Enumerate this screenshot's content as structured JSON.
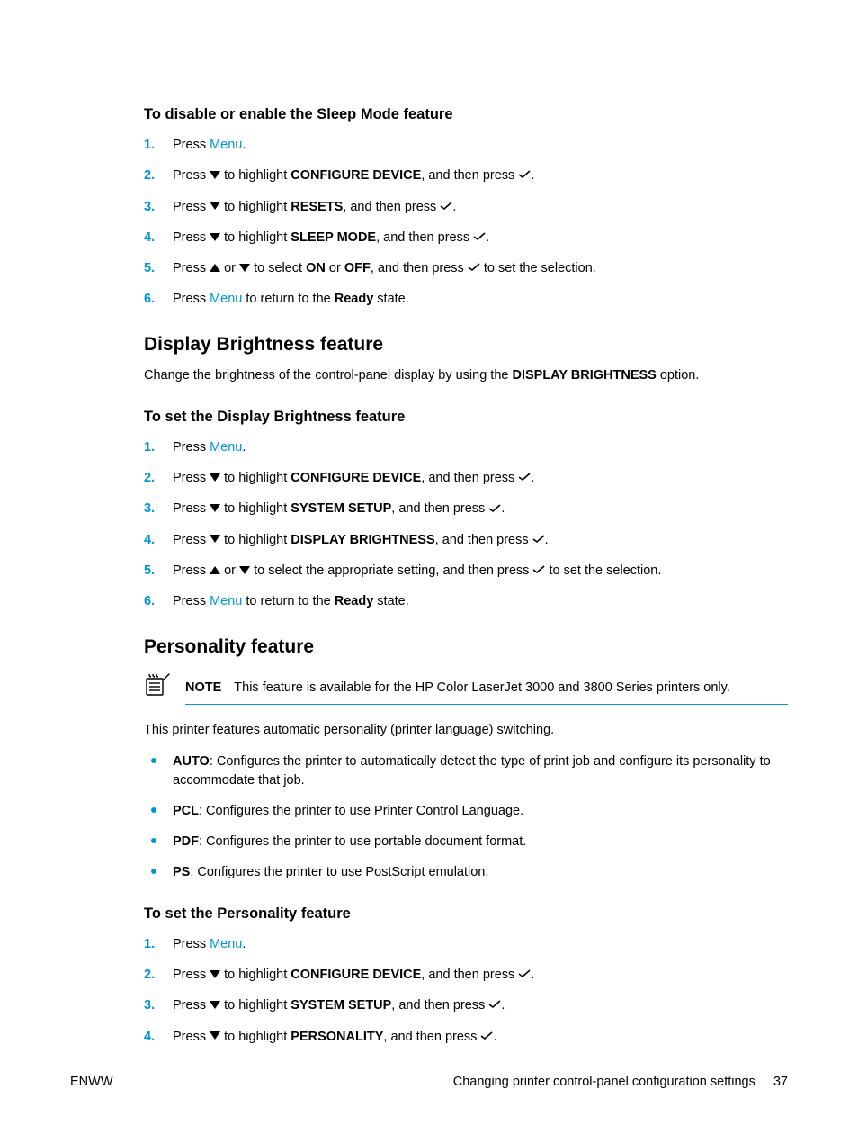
{
  "sec1": {
    "heading": "To disable or enable the Sleep Mode feature",
    "steps": [
      {
        "n": "1.",
        "pre": "Press ",
        "link": "Menu",
        "post": "."
      },
      {
        "n": "2.",
        "pre": "Press ",
        "icon1": "down",
        "mid1": " to highlight ",
        "bold": "CONFIGURE DEVICE",
        "mid2": ", and then press ",
        "icon2": "check",
        "post": "."
      },
      {
        "n": "3.",
        "pre": "Press ",
        "icon1": "down",
        "mid1": " to highlight ",
        "bold": "RESETS",
        "mid2": ", and then press ",
        "icon2": "check",
        "post": "."
      },
      {
        "n": "4.",
        "pre": "Press ",
        "icon1": "down",
        "mid1": " to highlight ",
        "bold": "SLEEP MODE",
        "mid2": ", and then press ",
        "icon2": "check",
        "post": "."
      },
      {
        "n": "5.",
        "pre": "Press ",
        "icon1": "up",
        "mid0": " or ",
        "icon1b": "down",
        "mid1": " to select ",
        "bold": "ON",
        "mid1b": " or ",
        "bold2": "OFF",
        "mid2": ", and then press ",
        "icon2": "check",
        "post": " to set the selection."
      },
      {
        "n": "6.",
        "pre": "Press ",
        "link": "Menu",
        "mid1": " to return to the ",
        "bold": "Ready",
        "post": " state."
      }
    ]
  },
  "sec2": {
    "heading": "Display Brightness feature",
    "intro_pre": "Change the brightness of the control-panel display by using the ",
    "intro_bold": "DISPLAY BRIGHTNESS",
    "intro_post": " option.",
    "subheading": "To set the Display Brightness feature",
    "steps": [
      {
        "n": "1.",
        "pre": "Press ",
        "link": "Menu",
        "post": "."
      },
      {
        "n": "2.",
        "pre": "Press ",
        "icon1": "down",
        "mid1": " to highlight ",
        "bold": "CONFIGURE DEVICE",
        "mid2": ", and then press ",
        "icon2": "check",
        "post": "."
      },
      {
        "n": "3.",
        "pre": "Press ",
        "icon1": "down",
        "mid1": " to highlight ",
        "bold": "SYSTEM SETUP",
        "mid2": ", and then press ",
        "icon2": "check",
        "post": "."
      },
      {
        "n": "4.",
        "pre": "Press ",
        "icon1": "down",
        "mid1": " to highlight ",
        "bold": "DISPLAY BRIGHTNESS",
        "mid2": ", and then press ",
        "icon2": "check",
        "post": "."
      },
      {
        "n": "5.",
        "pre": "Press ",
        "icon1": "up",
        "mid0": " or ",
        "icon1b": "down",
        "mid1": " to select the appropriate setting, and then press ",
        "icon2": "check",
        "post": " to set the selection."
      },
      {
        "n": "6.",
        "pre": "Press ",
        "link": "Menu",
        "mid1": " to return to the ",
        "bold": "Ready",
        "post": " state."
      }
    ]
  },
  "sec3": {
    "heading": "Personality feature",
    "note_label": "NOTE",
    "note_text": "This feature is available for the HP Color LaserJet 3000 and 3800 Series printers only.",
    "intro": "This printer features automatic personality (printer language) switching.",
    "bullets": [
      {
        "bold": "AUTO",
        "text": ": Configures the printer to automatically detect the type of print job and configure its personality to accommodate that job."
      },
      {
        "bold": "PCL",
        "text": ": Configures the printer to use Printer Control Language."
      },
      {
        "bold": "PDF",
        "text": ": Configures the printer to use portable document format."
      },
      {
        "bold": "PS",
        "text": ": Configures the printer to use PostScript emulation."
      }
    ],
    "subheading": "To set the Personality feature",
    "steps": [
      {
        "n": "1.",
        "pre": "Press ",
        "link": "Menu",
        "post": "."
      },
      {
        "n": "2.",
        "pre": "Press ",
        "icon1": "down",
        "mid1": " to highlight ",
        "bold": "CONFIGURE DEVICE",
        "mid2": ", and then press ",
        "icon2": "check",
        "post": "."
      },
      {
        "n": "3.",
        "pre": "Press ",
        "icon1": "down",
        "mid1": " to highlight ",
        "bold": "SYSTEM SETUP",
        "mid2": ", and then press ",
        "icon2": "check",
        "post": "."
      },
      {
        "n": "4.",
        "pre": "Press ",
        "icon1": "down",
        "mid1": " to highlight ",
        "bold": "PERSONALITY",
        "mid2": ", and then press ",
        "icon2": "check",
        "post": "."
      }
    ]
  },
  "footer": {
    "left": "ENWW",
    "right": "Changing printer control-panel configuration settings",
    "page": "37"
  }
}
